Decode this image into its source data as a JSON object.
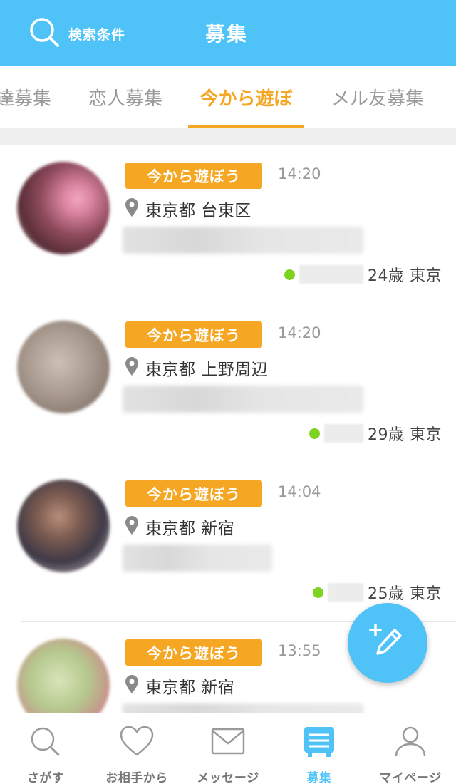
{
  "header": {
    "search_label": "検索条件",
    "title": "募集"
  },
  "tabs": [
    {
      "label": "達募集",
      "active": false
    },
    {
      "label": "恋人募集",
      "active": false
    },
    {
      "label": "今から遊ぼ",
      "active": true
    },
    {
      "label": "メル友募集",
      "active": false
    }
  ],
  "posts": [
    {
      "badge": "今から遊ぼう",
      "time": "14:20",
      "location": "東京都 台東区",
      "age_area": "24歳 東京",
      "online": true
    },
    {
      "badge": "今から遊ぼう",
      "time": "14:20",
      "location": "東京都 上野周辺",
      "age_area": "29歳 東京",
      "online": true
    },
    {
      "badge": "今から遊ぼう",
      "time": "14:04",
      "location": "東京都 新宿",
      "age_area": "25歳 東京",
      "online": true
    },
    {
      "badge": "今から遊ぼう",
      "time": "13:55",
      "location": "東京都 新宿",
      "age_area": "",
      "online": true
    }
  ],
  "bottom_nav": [
    {
      "label": "さがす",
      "icon": "search-icon",
      "active": false
    },
    {
      "label": "お相手から",
      "icon": "heart-icon",
      "active": false
    },
    {
      "label": "メッセージ",
      "icon": "envelope-icon",
      "active": false
    },
    {
      "label": "募集",
      "icon": "board-icon",
      "active": true
    },
    {
      "label": "マイページ",
      "icon": "person-icon",
      "active": false
    }
  ],
  "fab": {
    "icon": "new-post-pencil-icon"
  },
  "colors": {
    "header": "#4fc3f7",
    "accent": "#f5a623",
    "online": "#7ed321",
    "nav_active": "#4fc3f7"
  }
}
